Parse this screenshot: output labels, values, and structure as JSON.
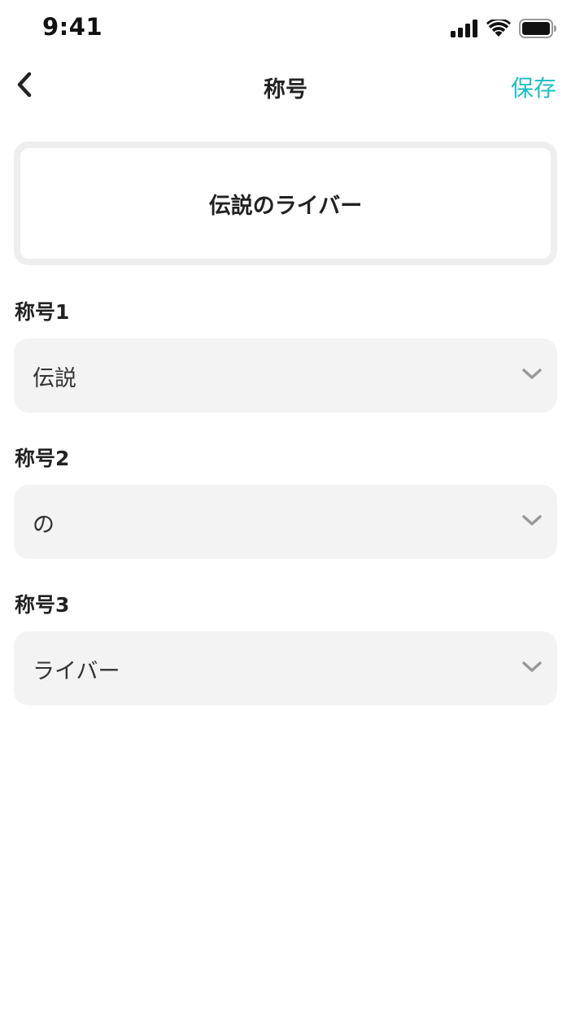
{
  "status_bar": {
    "time": "9:41",
    "icons": [
      "signal-icon",
      "wifi-icon",
      "battery-icon"
    ]
  },
  "nav": {
    "back_icon": "chevron-left-icon",
    "title": "称号",
    "save_label": "保存"
  },
  "preview": {
    "title_text": "伝説のライバー"
  },
  "fields": [
    {
      "label": "称号1",
      "value": "伝説",
      "icon": "chevron-down-icon"
    },
    {
      "label": "称号2",
      "value": "の",
      "icon": "chevron-down-icon"
    },
    {
      "label": "称号3",
      "value": "ライバー",
      "icon": "chevron-down-icon"
    }
  ],
  "colors": {
    "accent": "#1cc0c4",
    "select_background": "#f3f3f3",
    "card_border": "#eeeeee",
    "chevron": "#999999"
  }
}
